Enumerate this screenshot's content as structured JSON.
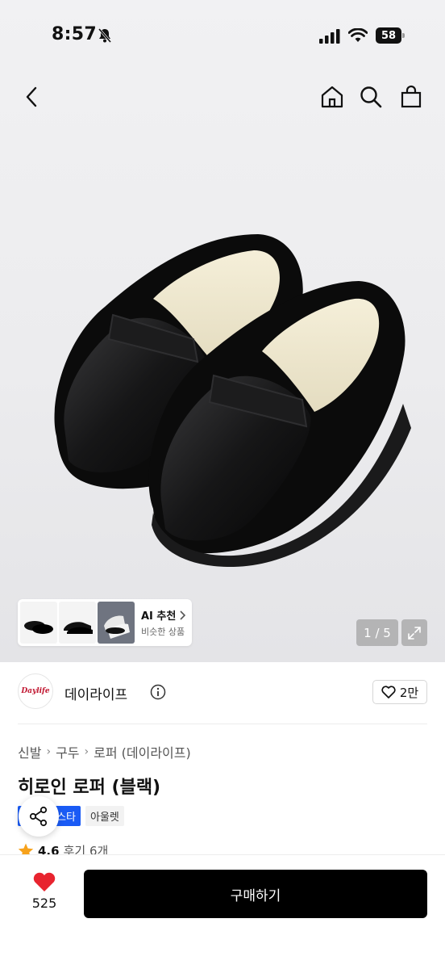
{
  "status_bar": {
    "time": "8:57",
    "battery": "58"
  },
  "nav": {
    "back_icon": "chevron-left-icon",
    "home_icon": "home-icon",
    "search_icon": "search-icon",
    "cart_icon": "bag-icon"
  },
  "gallery": {
    "ai_title": "AI 추천",
    "ai_subtitle": "비슷한 상품",
    "counter": "1 / 5"
  },
  "brand": {
    "logo_text": "Daylife",
    "name": "데이라이프",
    "like_count": "2만"
  },
  "breadcrumb": [
    "신발",
    "구두",
    "로퍼 (데이라이프)"
  ],
  "product": {
    "title": "히로인 로퍼 (블랙)"
  },
  "badges": {
    "primary": "스타",
    "secondary": "아울렛"
  },
  "rating": {
    "score": "4.6",
    "reviews": "후기 6개"
  },
  "bottom": {
    "wish_count": "525",
    "buy_label": "구매하기"
  },
  "colors": {
    "accent_red": "#e8242f",
    "badge_blue": "#1a5bf5",
    "star": "#f7a21b",
    "buy_bg": "#000000"
  }
}
